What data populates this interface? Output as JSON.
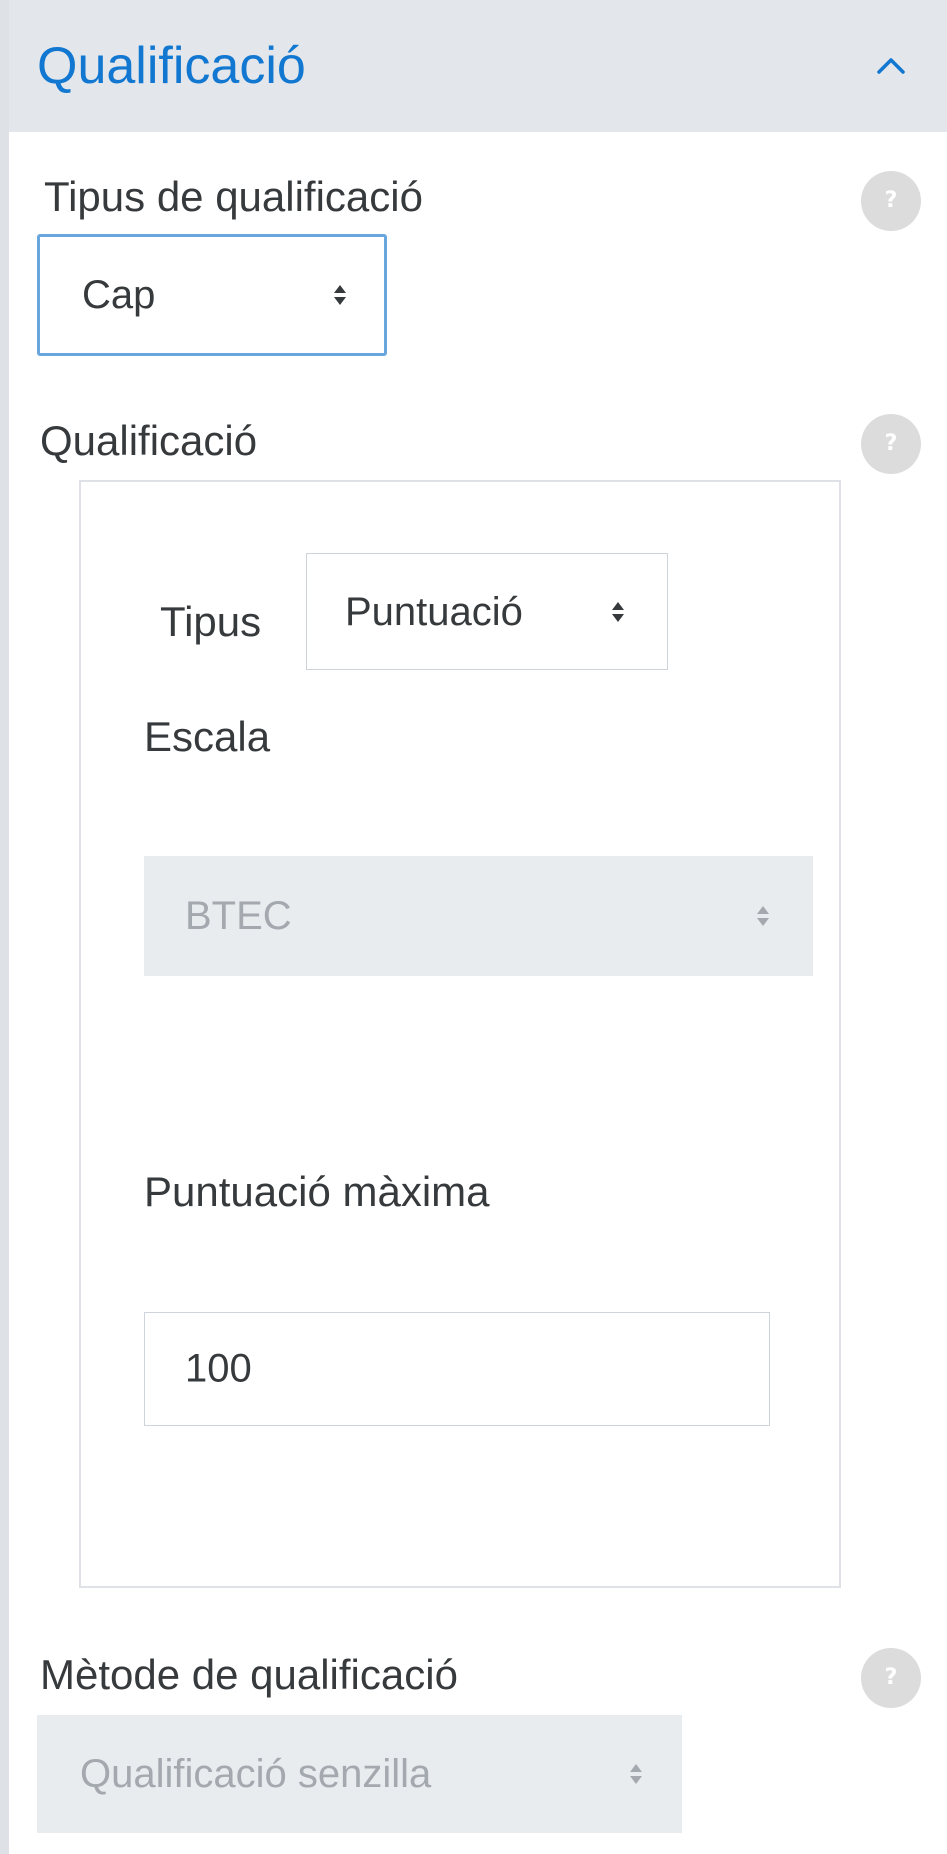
{
  "section": {
    "title": "Qualificació",
    "collapse_icon": "chevron-up-icon",
    "accent_color": "#1177d1",
    "header_bg": "#e3e6ea"
  },
  "grade_type": {
    "label": "Tipus de qualificació",
    "selected": "Cap",
    "help_icon": "?"
  },
  "grade": {
    "label": "Qualificació",
    "help_icon": "?",
    "type_label": "Tipus",
    "type_selected": "Puntuació",
    "scale_label": "Escala",
    "scale_selected": "BTEC",
    "max_grade_label": "Puntuació màxima",
    "max_grade_value": "100"
  },
  "grading_method": {
    "label": "Mètode de qualificació",
    "selected": "Qualificació senzilla",
    "help_icon": "?"
  }
}
